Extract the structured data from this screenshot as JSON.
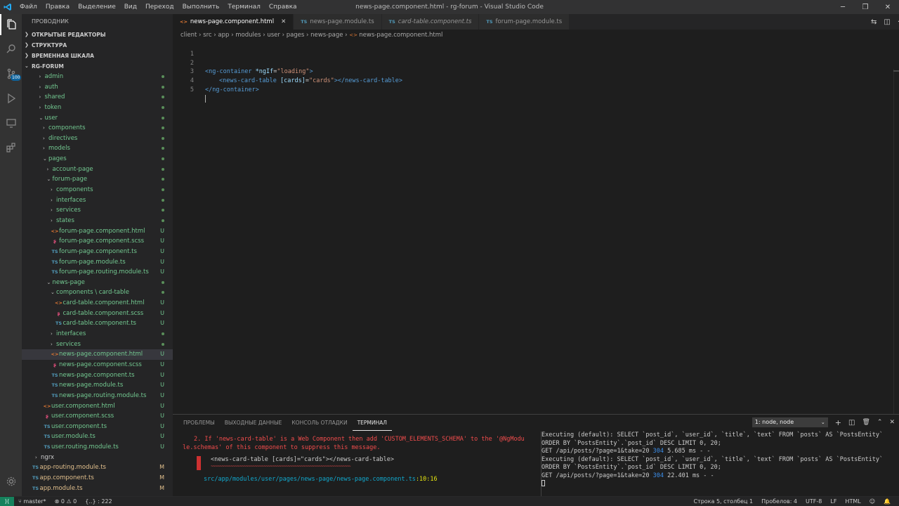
{
  "titlebar": {
    "menu": [
      "Файл",
      "Правка",
      "Выделение",
      "Вид",
      "Переход",
      "Выполнить",
      "Терминал",
      "Справка"
    ],
    "title": "news-page.component.html - rg-forum - Visual Studio Code"
  },
  "activity": {
    "scm_badge": "100"
  },
  "sidebar": {
    "title": "ПРОВОДНИК",
    "sections": [
      "ОТКРЫТЫЕ РЕДАКТОРЫ",
      "СТРУКТУРА",
      "ВРЕМЕННАЯ ШКАЛА",
      "RG-FORUM"
    ],
    "tree": [
      {
        "label": "admin",
        "kind": "folder",
        "depth": 3,
        "open": false,
        "status": "dot"
      },
      {
        "label": "auth",
        "kind": "folder",
        "depth": 3,
        "open": false,
        "status": "dot"
      },
      {
        "label": "shared",
        "kind": "folder",
        "depth": 3,
        "open": false,
        "status": "dot"
      },
      {
        "label": "token",
        "kind": "folder",
        "depth": 3,
        "open": false,
        "status": "dot"
      },
      {
        "label": "user",
        "kind": "folder",
        "depth": 3,
        "open": true,
        "status": "dot"
      },
      {
        "label": "components",
        "kind": "folder",
        "depth": 4,
        "open": false,
        "status": "dot"
      },
      {
        "label": "directives",
        "kind": "folder",
        "depth": 4,
        "open": false,
        "status": "dot"
      },
      {
        "label": "models",
        "kind": "folder",
        "depth": 4,
        "open": false,
        "status": "dot"
      },
      {
        "label": "pages",
        "kind": "folder",
        "depth": 4,
        "open": true,
        "status": "dot"
      },
      {
        "label": "account-page",
        "kind": "folder",
        "depth": 5,
        "open": false,
        "status": "dot"
      },
      {
        "label": "forum-page",
        "kind": "folder",
        "depth": 5,
        "open": true,
        "status": "dot"
      },
      {
        "label": "components",
        "kind": "folder",
        "depth": 6,
        "open": false,
        "status": "dot"
      },
      {
        "label": "interfaces",
        "kind": "folder",
        "depth": 6,
        "open": false,
        "status": "dot"
      },
      {
        "label": "services",
        "kind": "folder",
        "depth": 6,
        "open": false,
        "status": "dot"
      },
      {
        "label": "states",
        "kind": "folder",
        "depth": 6,
        "open": false,
        "status": "dot"
      },
      {
        "label": "forum-page.component.html",
        "kind": "html",
        "depth": 6,
        "status": "U"
      },
      {
        "label": "forum-page.component.scss",
        "kind": "scss",
        "depth": 6,
        "status": "U"
      },
      {
        "label": "forum-page.component.ts",
        "kind": "ts",
        "depth": 6,
        "status": "U"
      },
      {
        "label": "forum-page.module.ts",
        "kind": "ts",
        "depth": 6,
        "status": "U"
      },
      {
        "label": "forum-page.routing.module.ts",
        "kind": "ts",
        "depth": 6,
        "status": "U"
      },
      {
        "label": "news-page",
        "kind": "folder",
        "depth": 5,
        "open": true,
        "status": "dot"
      },
      {
        "label": "components \\ card-table",
        "kind": "folder",
        "depth": 6,
        "open": true,
        "status": "dot"
      },
      {
        "label": "card-table.component.html",
        "kind": "html",
        "depth": 7,
        "status": "U"
      },
      {
        "label": "card-table.component.scss",
        "kind": "scss",
        "depth": 7,
        "status": "U"
      },
      {
        "label": "card-table.component.ts",
        "kind": "ts",
        "depth": 7,
        "status": "U"
      },
      {
        "label": "interfaces",
        "kind": "folder",
        "depth": 6,
        "open": false,
        "status": "dot"
      },
      {
        "label": "services",
        "kind": "folder",
        "depth": 6,
        "open": false,
        "status": "dot"
      },
      {
        "label": "news-page.component.html",
        "kind": "html",
        "depth": 6,
        "status": "U",
        "selected": true
      },
      {
        "label": "news-page.component.scss",
        "kind": "scss",
        "depth": 6,
        "status": "U"
      },
      {
        "label": "news-page.component.ts",
        "kind": "ts",
        "depth": 6,
        "status": "U"
      },
      {
        "label": "news-page.module.ts",
        "kind": "ts",
        "depth": 6,
        "status": "U"
      },
      {
        "label": "news-page.routing.module.ts",
        "kind": "ts",
        "depth": 6,
        "status": "U"
      },
      {
        "label": "user.component.html",
        "kind": "html",
        "depth": 4,
        "status": "U"
      },
      {
        "label": "user.component.scss",
        "kind": "scss",
        "depth": 4,
        "status": "U"
      },
      {
        "label": "user.component.ts",
        "kind": "ts",
        "depth": 4,
        "status": "U"
      },
      {
        "label": "user.module.ts",
        "kind": "ts",
        "depth": 4,
        "status": "U"
      },
      {
        "label": "user.routing.module.ts",
        "kind": "ts",
        "depth": 4,
        "status": "U"
      },
      {
        "label": "ngrx",
        "kind": "folder-plain",
        "depth": 2,
        "open": false,
        "status": ""
      },
      {
        "label": "app-routing.module.ts",
        "kind": "ts",
        "depth": 1,
        "status": "M"
      },
      {
        "label": "app.component.ts",
        "kind": "ts",
        "depth": 1,
        "status": "M"
      },
      {
        "label": "app.module.ts",
        "kind": "ts",
        "depth": 1,
        "status": "M"
      }
    ]
  },
  "tabs": [
    {
      "label": "news-page.component.html",
      "icon": "<>",
      "active": true,
      "italic": false
    },
    {
      "label": "news-page.module.ts",
      "icon": "TS",
      "active": false,
      "italic": false
    },
    {
      "label": "card-table.component.ts",
      "icon": "TS",
      "active": false,
      "italic": true
    },
    {
      "label": "forum-page.module.ts",
      "icon": "TS",
      "active": false,
      "italic": false
    }
  ],
  "breadcrumb": [
    "client",
    "src",
    "app",
    "modules",
    "user",
    "pages",
    "news-page",
    "news-page.component.html"
  ],
  "code": {
    "line_numbers": [
      "1",
      "2",
      "3",
      "4",
      "5"
    ],
    "l2": {
      "open": "<ng-container",
      "attr": "*ngIf",
      "eq": "=",
      "val": "\"loading\"",
      "close": ">"
    },
    "l3": {
      "open": "<news-card-table",
      "attr": "[cards]",
      "eq": "=",
      "val": "\"cards\"",
      "close": "></news-card-table>"
    },
    "l4": {
      "close": "</ng-container>"
    }
  },
  "panel": {
    "tabs": [
      "ПРОБЛЕМЫ",
      "ВЫХОДНЫЕ ДАННЫЕ",
      "КОНСОЛЬ ОТЛАДКИ",
      "ТЕРМИНАЛ"
    ],
    "active_tab": "ТЕРМИНАЛ",
    "terminal_select": "1: node, node",
    "error_line1": "2. If 'news-card-table' is a Web Component then add 'CUSTOM_ELEMENTS_SCHEMA' to the '@NgModu",
    "error_line2": "le.schemas' of this component to suppress this message.",
    "snippet": "<news-card-table [cards]=\"cards\"></news-card-table>",
    "squiggle": "~~~~~~~~~~~~~~~~~~~~~~~~~~~~~~~~~~~~~~~~~~~~~~~~~~~~~~~~~~~~~~~~~~~~~~~~~~~~",
    "loc_path": "src/app/modules/user/pages/news-page/news-page.component.ts",
    "loc_pos": ":10:16",
    "log": [
      "Executing (default): SELECT `post_id`, `user_id`, `title`, `text` FROM `posts` AS `PostsEntity`",
      "ORDER BY `PostsEntity`.`post_id` DESC LIMIT 0, 20;",
      "GET /api/posts/?page=1&take=20 ",
      "Executing (default): SELECT `post_id`, `user_id`, `title`, `text` FROM `posts` AS `PostsEntity`",
      "ORDER BY `PostsEntity`.`post_id` DESC LIMIT 0, 20;",
      "GET /api/posts/?page=1&take=20 "
    ],
    "log_status": "304",
    "log_time1": " 5.685 ms - -",
    "log_time2": " 22.401 ms - -"
  },
  "statusbar": {
    "branch": "master*",
    "errors": "0",
    "warnings": "0",
    "selection": "{..} : 222",
    "position": "Строка 5, столбец 1",
    "spaces": "Пробелов: 4",
    "encoding": "UTF-8",
    "eol": "LF",
    "language": "HTML"
  },
  "colors": {
    "accent": "#007acc",
    "untracked": "#73c991",
    "modified": "#e2c08d",
    "error": "#f14c4c"
  }
}
